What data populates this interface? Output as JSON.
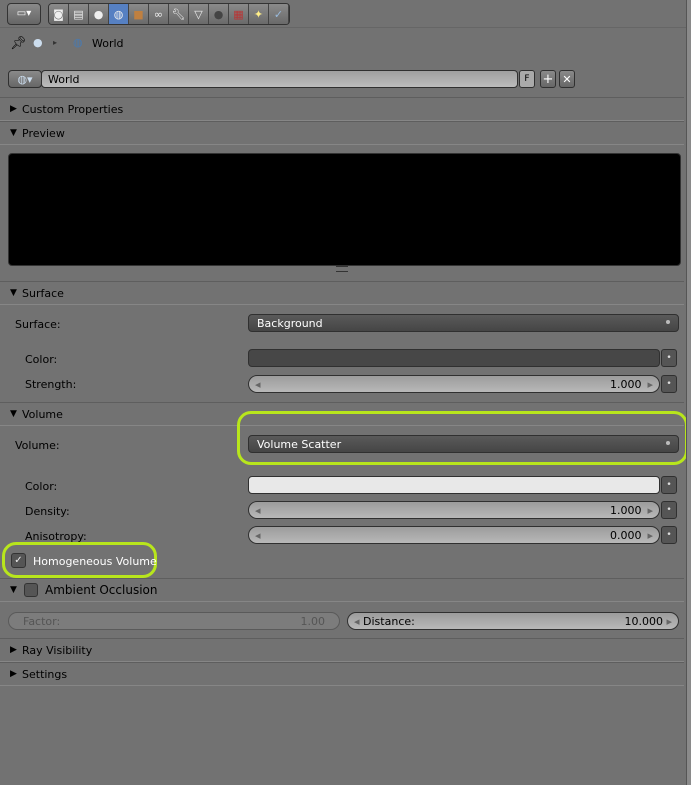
{
  "header": {
    "editor_icon": "properties-editor-icon",
    "context_tabs": [
      "render-icon",
      "render-layers-icon",
      "scene-icon",
      "world-icon",
      "object-icon",
      "constraints-icon",
      "modifiers-icon",
      "data-icon",
      "material-icon",
      "texture-icon",
      "particles-icon",
      "physics-icon"
    ],
    "active_tab": "world-icon"
  },
  "breadcrumb": {
    "item": "World"
  },
  "datablock": {
    "name": "World",
    "fake_user": "F"
  },
  "panels": {
    "custom_properties": "Custom Properties",
    "preview": "Preview",
    "surface": {
      "title": "Surface",
      "surface_label": "Surface:",
      "surface_value": "Background",
      "color_label": "Color:",
      "color_value": "#474747",
      "strength_label": "Strength:",
      "strength_value": "1.000"
    },
    "volume": {
      "title": "Volume",
      "volume_label": "Volume:",
      "volume_value": "Volume Scatter",
      "color_label": "Color:",
      "color_value": "#e8e8e8",
      "density_label": "Density:",
      "density_value": "1.000",
      "anisotropy_label": "Anisotropy:",
      "anisotropy_value": "0.000",
      "homogeneous_label": "Homogeneous Volume",
      "homogeneous_checked": true
    },
    "ambient_occlusion": {
      "title": "Ambient Occlusion",
      "enabled": false,
      "factor_label": "Factor:",
      "factor_value": "1.00",
      "distance_label": "Distance:",
      "distance_value": "10.000"
    },
    "ray_visibility": "Ray Visibility",
    "settings": "Settings"
  },
  "highlight_color": "#b8e61c"
}
